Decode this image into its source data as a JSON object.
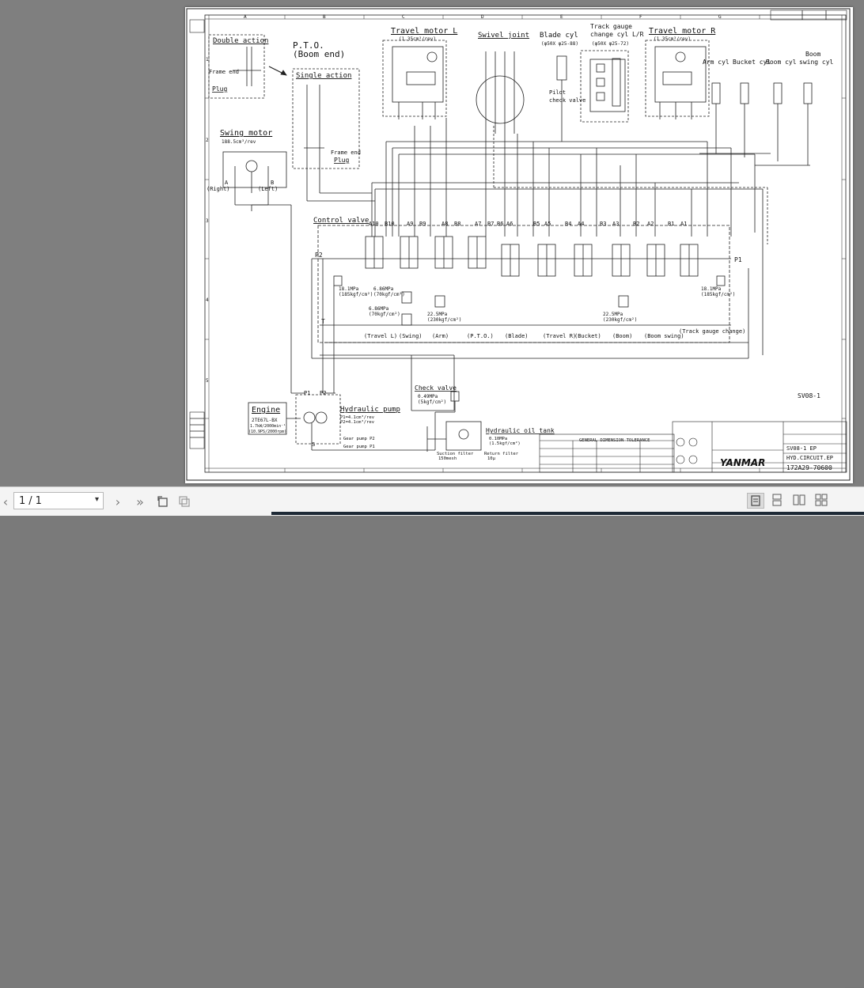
{
  "toolbar": {
    "prev_page": "‹",
    "current_page": "1",
    "page_separator": "/",
    "page_total": "1",
    "next_page": "›",
    "last_page": "»"
  },
  "drawing": {
    "double_action": "Double action",
    "frame_end": "Frame end",
    "plug": "Plug",
    "pto_line1": "P.T.O.",
    "pto_line2": "(Boom end)",
    "single_action": "Single action",
    "pto_frame_end": "Frame end",
    "pto_plug": "Plug",
    "swing_motor": "Swing motor",
    "swing_spec": "188.5cm³/rev",
    "swing_a": "A",
    "swing_right": "(Right)",
    "swing_b": "B",
    "swing_left": "(Left)",
    "travel_motor_l": "Travel motor L",
    "travel_motor_l_spec": "(1.35cm³/rev)",
    "swivel_joint": "Swivel joint",
    "blade_cyl": "Blade cyl",
    "blade_cyl_spec": "(φ50X φ25-88)",
    "track_gauge_1": "Track gauge",
    "track_gauge_2": "change cyl L/R",
    "track_gauge_spec": "(φ50X φ25-72)",
    "travel_motor_r": "Travel motor R",
    "travel_motor_r_spec": "(1.35cm³/rev)",
    "arm_cyl": "Arm cyl",
    "bucket_cyl": "Bucket cyl",
    "boom_cyl": "Boom cyl",
    "boom_swing_cyl_1": "Boom",
    "boom_swing_cyl_2": "swing cyl",
    "pilot_check_1": "Pilot",
    "pilot_check_2": "check valve",
    "control_valve": "Control valve",
    "p1": "P1",
    "p2": "P2",
    "t": "T",
    "port_labels": [
      "A10",
      "B10",
      "A9",
      "B9",
      "A8",
      "B8",
      "A7",
      "B7",
      "B6",
      "A6",
      "B5",
      "A5",
      "B4",
      "A4",
      "B3",
      "A3",
      "B2",
      "A2",
      "B1",
      "A1"
    ],
    "function_labels": [
      "(Travel L)",
      "(Swing)",
      "(Arm)",
      "(P.T.O.)",
      "(Blade)",
      "(Travel R)",
      "(Bucket)",
      "(Boom)",
      "(Boom swing)",
      "(Track gauge change)"
    ],
    "relief_left": "18.1MPa",
    "relief_left_2": "(185kgf/cm²)",
    "relief_right": "18.1MPa",
    "relief_right_2": "(185kgf/cm²)",
    "relief_a": "6.86MPa",
    "relief_a2": "(70kgf/cm²)",
    "relief_b": "6.86MPa",
    "relief_b2": "(70kgf/cm²)",
    "relief_c": "22.5MPa",
    "relief_c2": "(230kgf/cm²)",
    "relief_d": "22.5MPa",
    "relief_d2": "(230kgf/cm²)",
    "engine": "Engine",
    "engine_model": "2TE67L-BX",
    "engine_spec1": "1.7kW/2000min⁻¹",
    "engine_spec2": "(10.9PS/2000rpm)",
    "hydraulic_pump": "Hydraulic pump",
    "pump_spec1": "P1=4.1cm³/rev",
    "pump_spec2": "P2=4.1cm³/rev",
    "gear_pump_p2": "Gear pump P2",
    "gear_pump_p1": "Gear pump P1",
    "pump_p1": "P1",
    "pump_p2": "P2",
    "pump_s": "S",
    "check_valve": "Check valve",
    "check_spec1": "0.49MPa",
    "check_spec2": "(5kgf/cm²)",
    "hydraulic_oil_tank": "Hydraulic oil tank",
    "tank_spec1": "0.10MPa",
    "tank_spec2": "(1.5kgf/cm²)",
    "suction_filter": "Suction filter",
    "suction_mesh": "150mesh",
    "return_filter": "Return filter",
    "return_spec": "10μ",
    "ref_code": "SV08-1",
    "brand": "YANMAR",
    "title_model": "SV08-1 EP",
    "title_name": "HYD.CIRCUIT.EP",
    "drawing_no": "172A29-70600",
    "general_tolerance": "GENERAL DIMENSION TOLERANCE",
    "grid_top": [
      "A",
      "B",
      "C",
      "D",
      "E",
      "F",
      "G"
    ],
    "grid_side": [
      "1",
      "2",
      "3",
      "4",
      "5"
    ]
  }
}
